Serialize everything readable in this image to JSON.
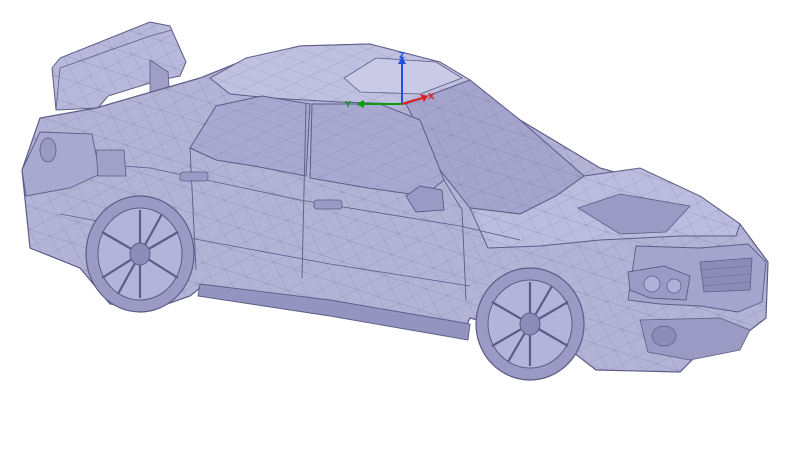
{
  "viewport": {
    "background": "#ffffff",
    "model": {
      "name": "car-mesh",
      "fill": "#b3b3d6",
      "fill_dark": "#8c8cb8",
      "fill_light": "#cacae6",
      "edge": "#5c5c88",
      "render_mode": "shaded-with-wireframe"
    },
    "triad": {
      "x_label": "X",
      "y_label": "Y",
      "z_label": "Z",
      "x_color": "#e02020",
      "y_color": "#109a10",
      "z_color": "#2050e0"
    }
  }
}
